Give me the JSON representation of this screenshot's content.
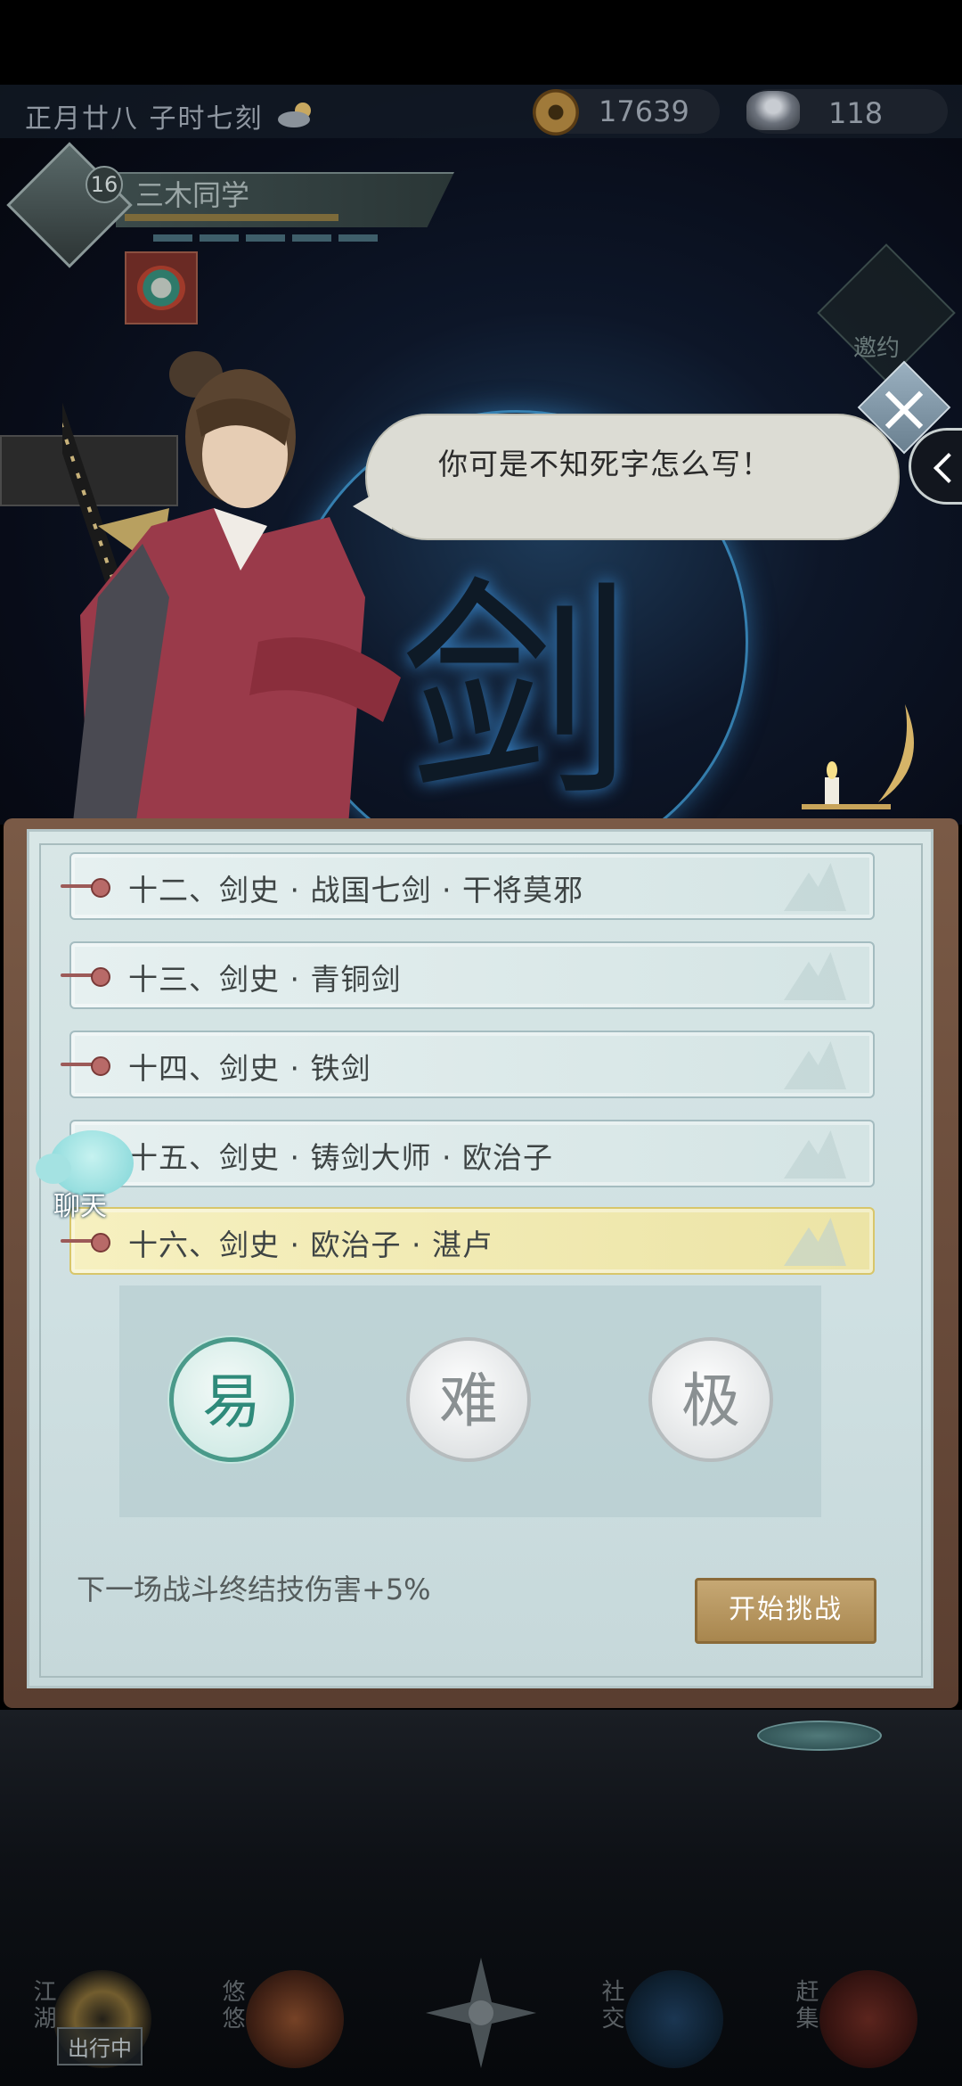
{
  "topbar": {
    "date": "正月廿八  子时七刻",
    "weather_icon": "sun-cloud-icon",
    "copper_coins": "17639",
    "silver": "118"
  },
  "player": {
    "level": "16",
    "name": "三木同学"
  },
  "invite": {
    "label": "邀约"
  },
  "dialogue": {
    "text": "你可是不知死字怎么写！"
  },
  "stages": [
    {
      "label": "十二、剑史 · 战国七剑 · 干将莫邪",
      "selected": false
    },
    {
      "label": "十三、剑史 · 青铜剑",
      "selected": false
    },
    {
      "label": "十四、剑史 · 铁剑",
      "selected": false
    },
    {
      "label": "十五、剑史 · 铸剑大师 · 欧治子",
      "selected": false
    },
    {
      "label": "十六、剑史 · 欧治子 · 湛卢",
      "selected": true
    }
  ],
  "difficulty": {
    "easy": "易",
    "hard": "难",
    "ultra": "极",
    "selected": "easy"
  },
  "bonus_text": "下一场战斗终结技伤害+5%",
  "start_button": "开始挑战",
  "chat": {
    "label": "聊天"
  },
  "bottom_nav": {
    "jianghu": "江湖",
    "youyou": "悠悠",
    "shejiao": "社交",
    "ganji": "赶集",
    "outing_status": "出行中"
  },
  "colors": {
    "panel_bg": "#d8e6e6",
    "selected_stage": "#f6f0c0",
    "easy_accent": "#2e8a7a",
    "start_button": "#b8965e",
    "pin": "#9c5a58"
  }
}
